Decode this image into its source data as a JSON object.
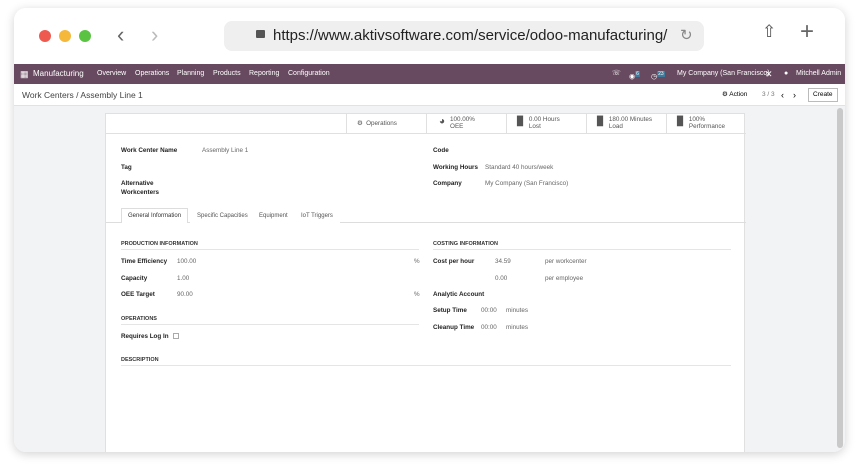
{
  "browser": {
    "url": "https://www.aktivsoftware.com/service/odoo-manufacturing/",
    "colors": {
      "red": "#ee5a4f",
      "yellow": "#f5b83a",
      "green": "#5ac442"
    }
  },
  "navbar": {
    "app": "Manufacturing",
    "menus": [
      "Overview",
      "Operations",
      "Planning",
      "Products",
      "Reporting",
      "Configuration"
    ],
    "messages_badge": "6",
    "activities_badge": "23",
    "company": "My Company (San Francisco)",
    "user": "Mitchell Admin",
    "color": "#684a60"
  },
  "control": {
    "breadcrumb": "Work Centers / Assembly Line 1",
    "action": "Action",
    "pager": "3 / 3",
    "create": "Create"
  },
  "stats": [
    {
      "label": "Operations"
    },
    {
      "value": "100.00%",
      "label": "OEE"
    },
    {
      "value": "0.00 Hours",
      "label": "Lost"
    },
    {
      "value": "180.00 Minutes",
      "label": "Load"
    },
    {
      "value": "100%",
      "label": "Performance"
    }
  ],
  "form": {
    "work_center_name_label": "Work Center Name",
    "work_center_name": "Assembly Line 1",
    "tag_label": "Tag",
    "alt_label_1": "Alternative",
    "alt_label_2": "Workcenters",
    "code_label": "Code",
    "working_hours_label": "Working Hours",
    "working_hours": "Standard 40 hours/week",
    "company_label": "Company",
    "company": "My Company (San Francisco)",
    "tabs": [
      "General Information",
      "Specific Capacities",
      "Equipment",
      "IoT Triggers"
    ],
    "production": {
      "title": "PRODUCTION INFORMATION",
      "time_eff_label": "Time Efficiency",
      "time_eff": "100.00",
      "capacity_label": "Capacity",
      "capacity": "1.00",
      "oee_label": "OEE Target",
      "oee": "90.00",
      "pct": "%"
    },
    "operations": {
      "title": "OPERATIONS",
      "requires_login": "Requires Log In"
    },
    "description": {
      "title": "DESCRIPTION"
    },
    "costing": {
      "title": "COSTING INFORMATION",
      "cost_label": "Cost per hour",
      "cost_wc": "34.59",
      "per_wc": "per workcenter",
      "cost_emp": "0.00",
      "per_emp": "per employee",
      "analytic_label": "Analytic Account",
      "setup_label": "Setup Time",
      "setup": "00:00",
      "cleanup_label": "Cleanup Time",
      "cleanup": "00:00",
      "minutes": "minutes"
    }
  }
}
